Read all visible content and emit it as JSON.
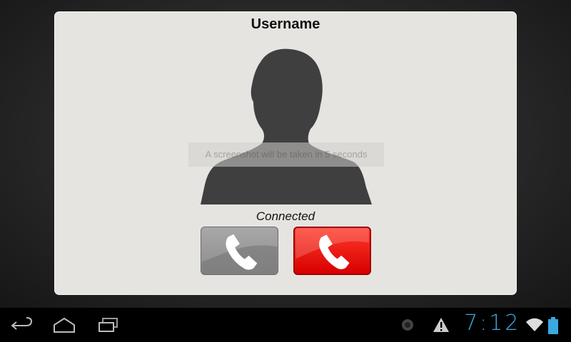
{
  "dialog": {
    "title": "Username",
    "toast_text": "A screenshot will be taken in 5 seconds",
    "call_status": "Connected",
    "answer_button_icon": "phone-icon",
    "hangup_button_icon": "phone-icon",
    "colors": {
      "answer": "#999999",
      "hangup": "#e80e0e",
      "background": "#e6e4e0"
    }
  },
  "system_bar": {
    "nav_icons": [
      "back-icon",
      "home-icon",
      "recent-apps-icon"
    ],
    "status_icons": [
      "notification-dot-icon",
      "warning-icon",
      "wifi-icon",
      "battery-icon"
    ],
    "time": "7:12",
    "time_color": "#3aa9e0"
  }
}
